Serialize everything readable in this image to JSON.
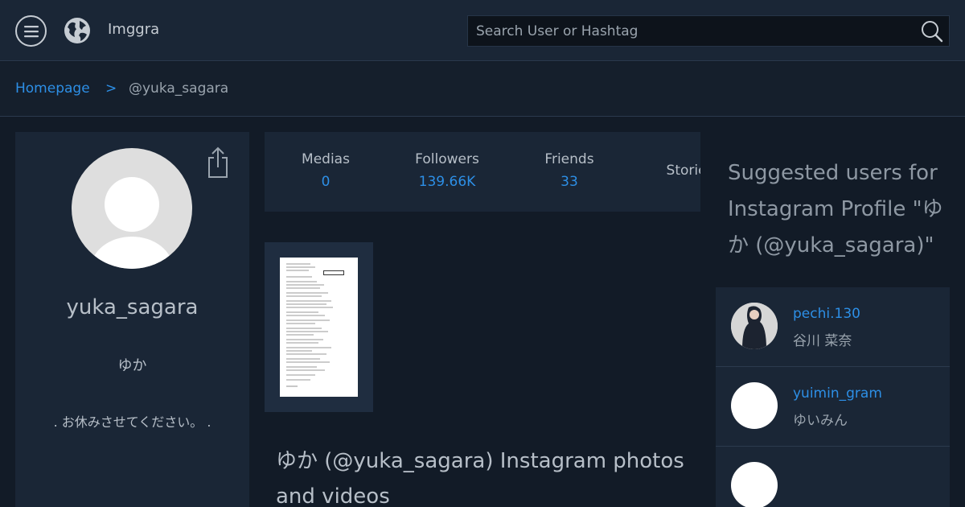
{
  "header": {
    "site_name": "Imggra",
    "search_placeholder": "Search User or Hashtag"
  },
  "breadcrumb": {
    "home": "Homepage",
    "separator": ">",
    "current": "@yuka_sagara"
  },
  "profile": {
    "username": "yuka_sagara",
    "full_name": "ゆか",
    "bio": ". お休みさせてください。 ."
  },
  "stats": [
    {
      "label": "Medias",
      "value": "0"
    },
    {
      "label": "Followers",
      "value": "139.66K"
    },
    {
      "label": "Friends",
      "value": "33"
    },
    {
      "label": "Stories",
      "value": ""
    }
  ],
  "page_heading": "ゆか (@yuka_sagara) Instagram photos and videos",
  "suggestions": {
    "title": "Suggested users for Instagram Profile \"ゆか (@yuka_sagara)\"",
    "users": [
      {
        "username": "pechi.130",
        "name": "谷川 菜奈"
      },
      {
        "username": "yuimin_gram",
        "name": "ゆいみん"
      },
      {
        "username": "",
        "name": ""
      }
    ]
  },
  "colors": {
    "accent": "#2d8fe6",
    "background": "#121b27",
    "panel": "#1a2636"
  }
}
